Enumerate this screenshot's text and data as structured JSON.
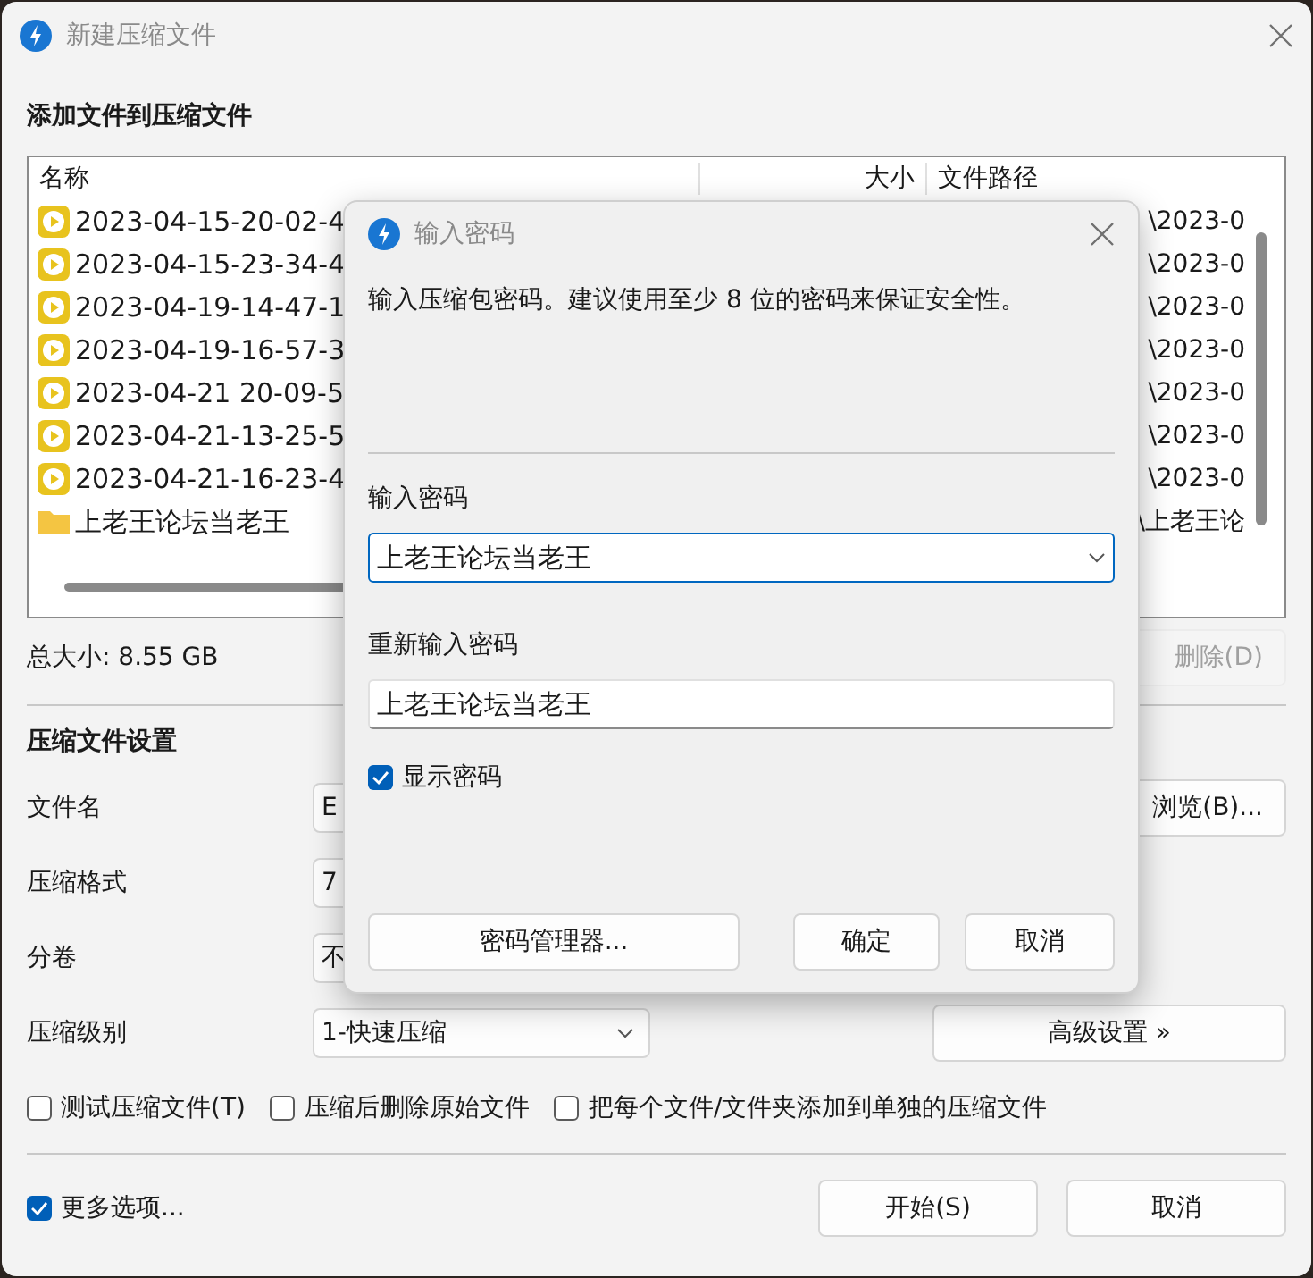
{
  "window": {
    "title": "新建压缩文件"
  },
  "files_section": {
    "heading": "添加文件到压缩文件",
    "columns": [
      "名称",
      "大小",
      "文件路径"
    ],
    "rows": [
      {
        "kind": "video",
        "name": "2023-04-15-20-02-4",
        "path": "\\2023-0"
      },
      {
        "kind": "video",
        "name": "2023-04-15-23-34-4",
        "path": "\\2023-0"
      },
      {
        "kind": "video",
        "name": "2023-04-19-14-47-1",
        "path": "\\2023-0"
      },
      {
        "kind": "video",
        "name": "2023-04-19-16-57-3",
        "path": "\\2023-0"
      },
      {
        "kind": "video",
        "name": "2023-04-21 20-09-5",
        "path": "\\2023-0"
      },
      {
        "kind": "video",
        "name": "2023-04-21-13-25-5",
        "path": "\\2023-0"
      },
      {
        "kind": "video",
        "name": "2023-04-21-16-23-4",
        "path": "\\2023-0"
      },
      {
        "kind": "folder",
        "name": "上老王论坛当老王",
        "path": "\\上老王论"
      }
    ],
    "total_size": "总大小: 8.55 GB",
    "delete_button": "删除(D)"
  },
  "settings": {
    "heading": "压缩文件设置",
    "fields": [
      {
        "label": "文件名",
        "kind": "input",
        "value": "E",
        "button": "浏览(B)..."
      },
      {
        "label": "压缩格式",
        "kind": "input",
        "value": "7"
      },
      {
        "label": "分卷",
        "kind": "input",
        "value": "不"
      },
      {
        "label": "压缩级别",
        "kind": "select",
        "value": "1-快速压缩",
        "button": "高级设置 »"
      }
    ],
    "options": [
      {
        "label": "测试压缩文件(T)",
        "checked": false
      },
      {
        "label": "压缩后删除原始文件",
        "checked": false
      },
      {
        "label": "把每个文件/文件夹添加到单独的压缩文件",
        "checked": false
      }
    ]
  },
  "footer": {
    "more_options": {
      "label": "更多选项...",
      "checked": true
    },
    "buttons": [
      "开始(S)",
      "取消"
    ]
  },
  "password_dialog": {
    "title": "输入密码",
    "message": "输入压缩包密码。建议使用至少 8 位的密码来保证安全性。",
    "password_label": "输入密码",
    "password_value": "上老王论坛当老王",
    "confirm_label": "重新输入密码",
    "confirm_value": "上老王论坛当老王",
    "show_password": {
      "label": "显示密码",
      "checked": true
    },
    "buttons": [
      "密码管理器...",
      "确定",
      "取消"
    ]
  }
}
